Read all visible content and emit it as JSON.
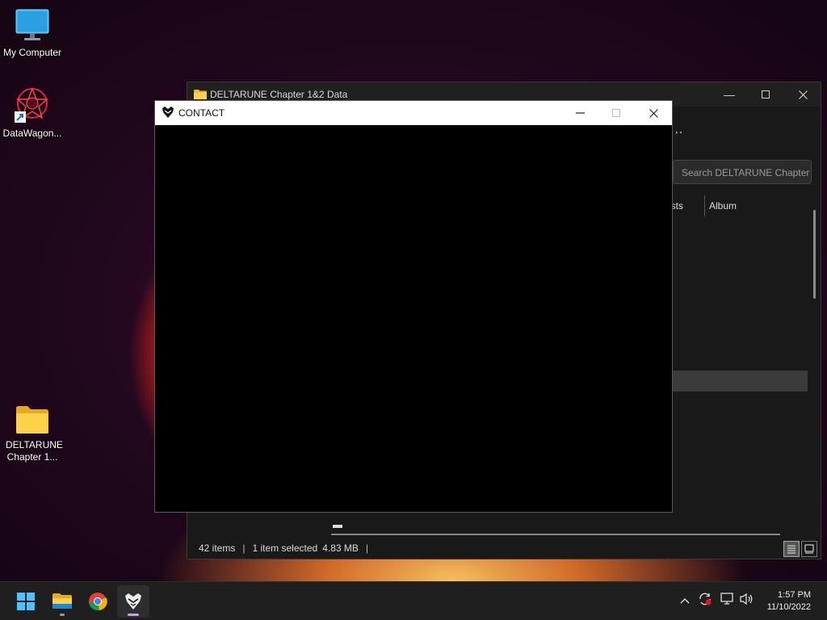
{
  "desktop": {
    "icons": [
      {
        "label": "My Computer"
      },
      {
        "label": "DataWagon..."
      },
      {
        "label": "DELTARUNE Chapter 1..."
      }
    ]
  },
  "explorer": {
    "title": "DELTARUNE Chapter 1&2 Data",
    "more_label": "...",
    "search_placeholder": "Search DELTARUNE Chapter ...",
    "columns": [
      "artists",
      "Album"
    ],
    "status": {
      "items": "42 items",
      "selected": "1 item selected",
      "size": "4.83 MB"
    }
  },
  "contact": {
    "title": "CONTACT"
  },
  "taskbar": {
    "apps": [
      "start-menu",
      "file-explorer",
      "chrome",
      "deltarune"
    ],
    "time": "1:57 PM",
    "date": "11/10/2022"
  },
  "colors": {
    "accent": "#0078d4",
    "taskbar_bg": "#1f1f1f",
    "window_dark": "#191919"
  }
}
